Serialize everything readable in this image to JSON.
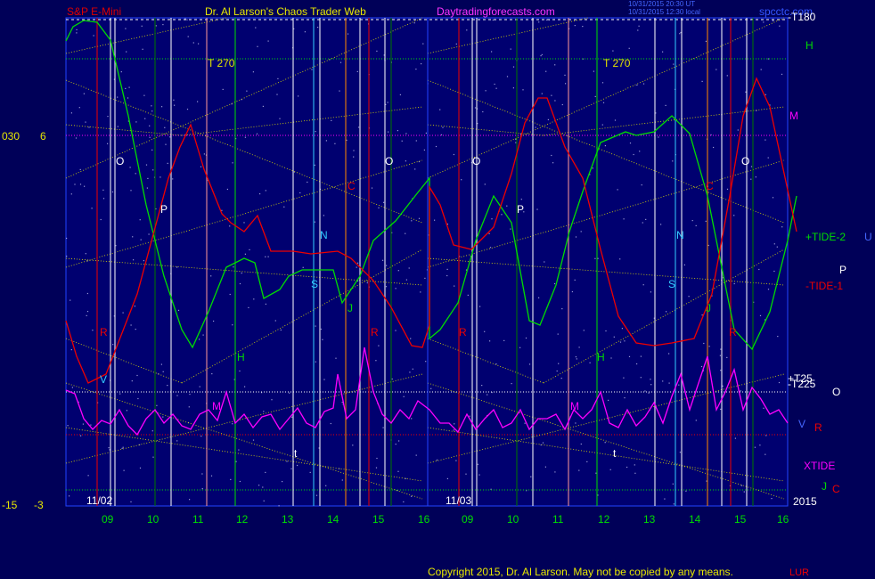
{
  "header": {
    "symbol": "S&P E-Mini",
    "site": "Dr. Al Larson's Chaos Trader Web",
    "url": "Daytradingforecasts.com",
    "stamp1": "10/31/2015 20:30 UT",
    "stamp2": "10/31/2015 12:30 local",
    "brand": "spcctc.com"
  },
  "footer": {
    "copyright": "Copyright 2015, Dr. Al Larson. May not be copied by any means.",
    "tail": "LUR"
  },
  "left_axis": {
    "top_a": "030",
    "top_b": "6",
    "bot_a": "-15",
    "bot_b": "-3"
  },
  "right_labels": {
    "t180": "-T180",
    "h": "H",
    "m": "M",
    "tide2": "+TIDE-2",
    "u": "U",
    "p": "P",
    "tide1": "-TIDE-1",
    "t25": "+T25",
    "t225": "-T225",
    "o": "O",
    "v": "V",
    "r": "R",
    "xtide": "XTIDE",
    "j": "J",
    "c": "C",
    "year": "2015"
  },
  "colors": {
    "bg": "#000058",
    "panel": "#000070",
    "green": "#00dd00",
    "red": "#ee0000",
    "magenta": "#ff00ff",
    "yellow": "#e0e000",
    "white": "#ffffff",
    "cyan": "#33ccff",
    "orange": "#ff8800",
    "darkgreen": "#007700",
    "pink": "#ff9999"
  },
  "chart_data": {
    "type": "line",
    "x_ticks": [
      "09",
      "10",
      "11",
      "12",
      "13",
      "14",
      "15",
      "16",
      "09",
      "10",
      "11",
      "12",
      "13",
      "14",
      "15",
      "16"
    ],
    "dates": [
      "11/02",
      "11/03"
    ],
    "series": [
      {
        "color": "green",
        "values": [
          [
            0,
            26
          ],
          [
            8,
            10
          ],
          [
            20,
            3
          ],
          [
            35,
            5
          ],
          [
            50,
            25
          ],
          [
            70,
            110
          ],
          [
            90,
            210
          ],
          [
            110,
            290
          ],
          [
            130,
            350
          ],
          [
            142,
            370
          ],
          [
            160,
            330
          ],
          [
            180,
            280
          ],
          [
            200,
            270
          ],
          [
            212,
            275
          ],
          [
            222,
            315
          ],
          [
            240,
            305
          ],
          [
            250,
            290
          ],
          [
            265,
            283
          ],
          [
            275,
            283
          ],
          [
            290,
            283
          ],
          [
            300,
            283
          ],
          [
            310,
            320
          ],
          [
            320,
            305
          ],
          [
            330,
            290
          ],
          [
            345,
            250
          ],
          [
            370,
            228
          ],
          [
            395,
            196
          ],
          [
            408,
            180
          ],
          [
            408,
            360
          ],
          [
            420,
            350
          ],
          [
            440,
            320
          ],
          [
            460,
            250
          ],
          [
            480,
            200
          ],
          [
            500,
            230
          ],
          [
            520,
            340
          ],
          [
            532,
            345
          ],
          [
            550,
            300
          ],
          [
            565,
            240
          ],
          [
            580,
            195
          ],
          [
            600,
            140
          ],
          [
            628,
            128
          ],
          [
            640,
            132
          ],
          [
            660,
            128
          ],
          [
            680,
            110
          ],
          [
            700,
            130
          ],
          [
            720,
            200
          ],
          [
            750,
            350
          ],
          [
            770,
            372
          ],
          [
            790,
            330
          ],
          [
            810,
            250
          ],
          [
            820,
            200
          ]
        ]
      },
      {
        "color": "red",
        "values": [
          [
            0,
            340
          ],
          [
            12,
            380
          ],
          [
            25,
            410
          ],
          [
            45,
            400
          ],
          [
            80,
            310
          ],
          [
            115,
            180
          ],
          [
            128,
            145
          ],
          [
            140,
            120
          ],
          [
            155,
            170
          ],
          [
            175,
            220
          ],
          [
            185,
            230
          ],
          [
            200,
            240
          ],
          [
            215,
            222
          ],
          [
            230,
            262
          ],
          [
            255,
            262
          ],
          [
            275,
            265
          ],
          [
            305,
            262
          ],
          [
            320,
            270
          ],
          [
            345,
            295
          ],
          [
            365,
            325
          ],
          [
            388,
            368
          ],
          [
            400,
            370
          ],
          [
            408,
            345
          ],
          [
            408,
            190
          ],
          [
            420,
            210
          ],
          [
            435,
            255
          ],
          [
            455,
            260
          ],
          [
            480,
            235
          ],
          [
            500,
            175
          ],
          [
            515,
            118
          ],
          [
            530,
            90
          ],
          [
            540,
            90
          ],
          [
            560,
            145
          ],
          [
            580,
            180
          ],
          [
            600,
            260
          ],
          [
            620,
            335
          ],
          [
            640,
            365
          ],
          [
            660,
            368
          ],
          [
            680,
            365
          ],
          [
            705,
            360
          ],
          [
            725,
            310
          ],
          [
            745,
            200
          ],
          [
            760,
            110
          ],
          [
            775,
            68
          ],
          [
            790,
            100
          ],
          [
            805,
            170
          ],
          [
            820,
            240
          ]
        ]
      },
      {
        "color": "magenta",
        "values": [
          [
            0,
            418
          ],
          [
            10,
            422
          ],
          [
            20,
            450
          ],
          [
            30,
            462
          ],
          [
            40,
            452
          ],
          [
            50,
            456
          ],
          [
            60,
            440
          ],
          [
            70,
            458
          ],
          [
            80,
            468
          ],
          [
            90,
            450
          ],
          [
            100,
            440
          ],
          [
            110,
            455
          ],
          [
            120,
            445
          ],
          [
            130,
            458
          ],
          [
            140,
            462
          ],
          [
            150,
            445
          ],
          [
            160,
            440
          ],
          [
            170,
            452
          ],
          [
            180,
            420
          ],
          [
            190,
            455
          ],
          [
            200,
            445
          ],
          [
            210,
            460
          ],
          [
            220,
            448
          ],
          [
            230,
            445
          ],
          [
            240,
            462
          ],
          [
            250,
            450
          ],
          [
            260,
            438
          ],
          [
            270,
            455
          ],
          [
            280,
            460
          ],
          [
            290,
            442
          ],
          [
            300,
            438
          ],
          [
            305,
            400
          ],
          [
            315,
            450
          ],
          [
            325,
            440
          ],
          [
            335,
            370
          ],
          [
            345,
            420
          ],
          [
            355,
            445
          ],
          [
            365,
            455
          ],
          [
            375,
            440
          ],
          [
            385,
            450
          ],
          [
            395,
            430
          ],
          [
            408,
            440
          ],
          [
            420,
            455
          ],
          [
            430,
            455
          ],
          [
            440,
            465
          ],
          [
            450,
            445
          ],
          [
            460,
            462
          ],
          [
            470,
            450
          ],
          [
            480,
            440
          ],
          [
            490,
            460
          ],
          [
            500,
            455
          ],
          [
            510,
            440
          ],
          [
            520,
            462
          ],
          [
            530,
            450
          ],
          [
            540,
            450
          ],
          [
            550,
            445
          ],
          [
            560,
            462
          ],
          [
            570,
            440
          ],
          [
            580,
            450
          ],
          [
            590,
            440
          ],
          [
            600,
            420
          ],
          [
            610,
            455
          ],
          [
            620,
            460
          ],
          [
            630,
            440
          ],
          [
            640,
            458
          ],
          [
            650,
            448
          ],
          [
            660,
            432
          ],
          [
            670,
            455
          ],
          [
            680,
            425
          ],
          [
            690,
            400
          ],
          [
            700,
            440
          ],
          [
            710,
            410
          ],
          [
            720,
            380
          ],
          [
            730,
            440
          ],
          [
            740,
            420
          ],
          [
            750,
            395
          ],
          [
            760,
            440
          ],
          [
            770,
            415
          ],
          [
            780,
            428
          ],
          [
            790,
            445
          ],
          [
            800,
            440
          ],
          [
            810,
            455
          ]
        ]
      }
    ]
  },
  "annotations": [
    {
      "t": "O",
      "x": 130,
      "y": 180,
      "c": "white"
    },
    {
      "t": "P",
      "x": 180,
      "y": 234,
      "c": "white"
    },
    {
      "t": "T   270",
      "x": 233,
      "y": 70,
      "c": "yellow"
    },
    {
      "t": "R",
      "x": 112,
      "y": 372,
      "c": "red"
    },
    {
      "t": "V",
      "x": 112,
      "y": 425,
      "c": "cyan"
    },
    {
      "t": "M",
      "x": 238,
      "y": 455,
      "c": "magenta"
    },
    {
      "t": "H",
      "x": 266,
      "y": 400,
      "c": "green"
    },
    {
      "t": "N",
      "x": 359,
      "y": 263,
      "c": "cyan"
    },
    {
      "t": "S",
      "x": 349,
      "y": 318,
      "c": "cyan"
    },
    {
      "t": "J",
      "x": 390,
      "y": 345,
      "c": "green"
    },
    {
      "t": "C",
      "x": 390,
      "y": 208,
      "c": "red"
    },
    {
      "t": "R",
      "x": 416,
      "y": 372,
      "c": "red"
    },
    {
      "t": "O",
      "x": 432,
      "y": 180,
      "c": "white"
    },
    {
      "t": "t",
      "x": 330,
      "y": 508,
      "c": "white"
    },
    {
      "t": "O",
      "x": 530,
      "y": 180,
      "c": "white"
    },
    {
      "t": "P",
      "x": 580,
      "y": 234,
      "c": "white"
    },
    {
      "t": "T   270",
      "x": 677,
      "y": 70,
      "c": "yellow"
    },
    {
      "t": "R",
      "x": 515,
      "y": 372,
      "c": "red"
    },
    {
      "t": "M",
      "x": 640,
      "y": 455,
      "c": "magenta"
    },
    {
      "t": "H",
      "x": 670,
      "y": 400,
      "c": "green"
    },
    {
      "t": "N",
      "x": 759,
      "y": 263,
      "c": "cyan"
    },
    {
      "t": "S",
      "x": 750,
      "y": 318,
      "c": "cyan"
    },
    {
      "t": "J",
      "x": 792,
      "y": 345,
      "c": "green"
    },
    {
      "t": "C",
      "x": 792,
      "y": 208,
      "c": "red"
    },
    {
      "t": "R",
      "x": 818,
      "y": 372,
      "c": "red"
    },
    {
      "t": "O",
      "x": 832,
      "y": 180,
      "c": "white"
    },
    {
      "t": "t",
      "x": 688,
      "y": 508,
      "c": "white"
    }
  ]
}
